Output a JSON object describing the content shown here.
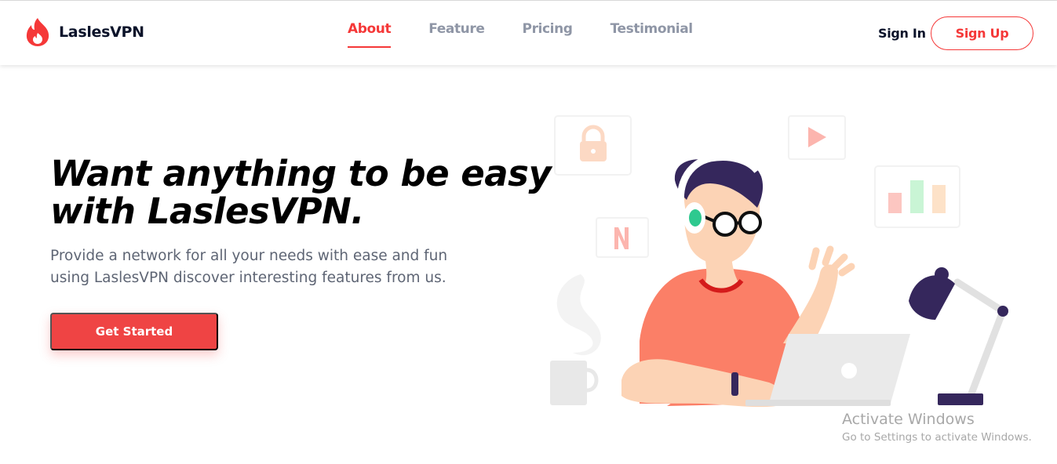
{
  "brand": {
    "name": "LaslesVPN",
    "accent": "#f53838"
  },
  "nav": {
    "links": [
      {
        "label": "About",
        "active": true
      },
      {
        "label": "Feature",
        "active": false
      },
      {
        "label": "Pricing",
        "active": false
      },
      {
        "label": "Testimonial",
        "active": false
      }
    ],
    "sign_in": "Sign In",
    "sign_up": "Sign Up"
  },
  "hero": {
    "title_line1": "Want anything to be easy",
    "title_line2": "with LaslesVPN.",
    "description": "Provide a network for all your needs with ease and fun using LaslesVPN discover interesting features from us.",
    "cta": "Get Started"
  },
  "illustration": {
    "icons": [
      "lock-icon",
      "play-icon",
      "netflix-icon",
      "bar-chart-icon",
      "coffee-mug",
      "desk-lamp",
      "laptop",
      "person-with-headphones"
    ],
    "netflix_letter": "N"
  },
  "watermark": {
    "title": "Activate Windows",
    "subtitle": "Go to Settings to activate Windows."
  }
}
